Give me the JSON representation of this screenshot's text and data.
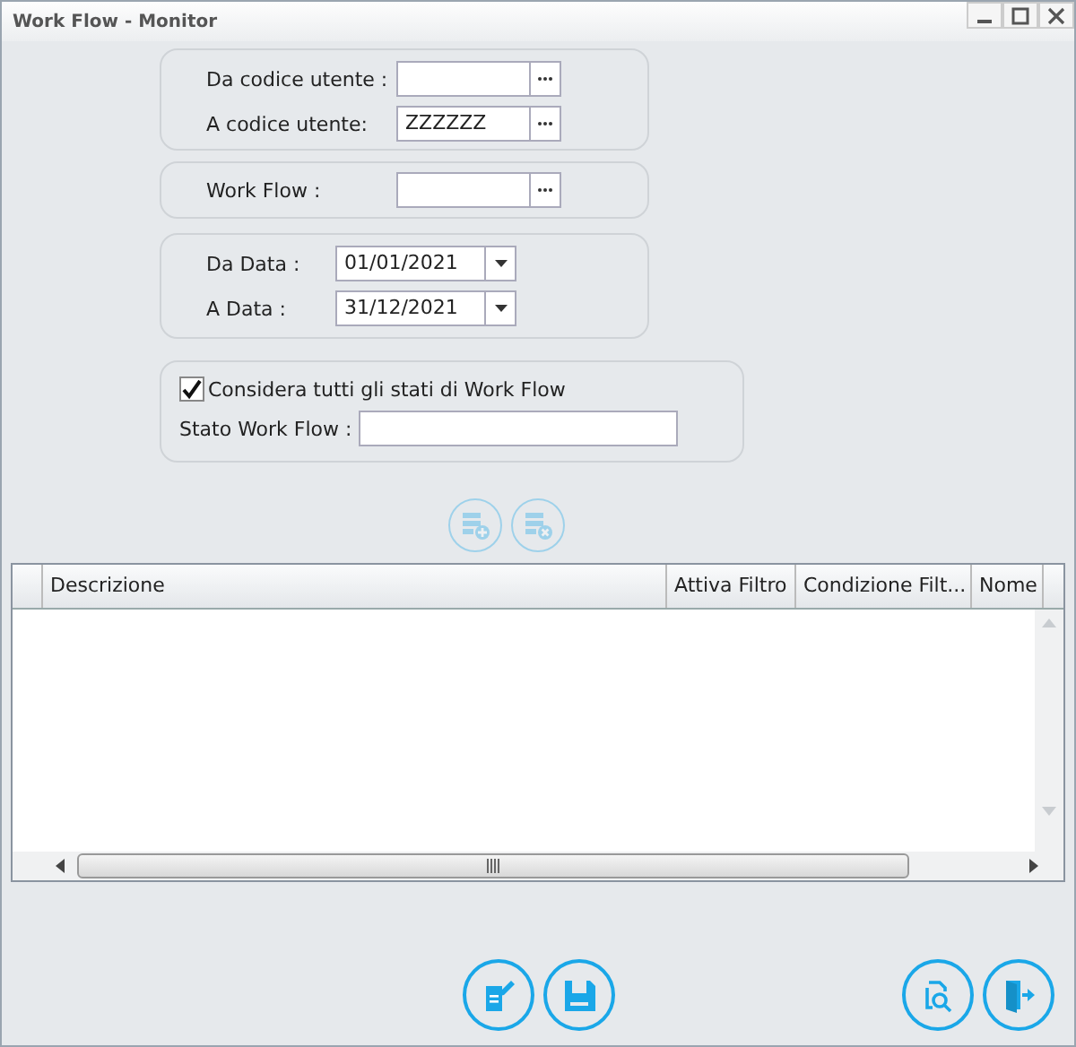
{
  "window": {
    "title": "Work Flow - Monitor"
  },
  "user_range": [
    {
      "label": "Da codice utente :"
    },
    {
      "label": "A codice utente:",
      "value": "ZZZZZZ"
    }
  ],
  "workflow": {
    "label": "Work Flow :"
  },
  "dates": [
    {
      "label": "Da Data :",
      "value": "01/01/2021"
    },
    {
      "label": "A Data :",
      "value": "31/12/2021"
    }
  ],
  "states": {
    "checkbox_label": "Considera tutti gli stati di Work Flow",
    "checked": true,
    "field_label": "Stato Work Flow :"
  },
  "filter_buttons": [
    {
      "kind": "add",
      "disabled": true
    },
    {
      "kind": "remove",
      "disabled": true
    }
  ],
  "table": {
    "columns": [
      "Descrizione",
      "Attiva Filtro",
      "Condizione Filt...",
      "Nome"
    ]
  },
  "actions": [
    {
      "kind": "edit",
      "disabled": false
    },
    {
      "kind": "save",
      "disabled": false
    },
    {
      "kind": "preview",
      "disabled": false
    },
    {
      "kind": "exit",
      "disabled": false
    }
  ]
}
